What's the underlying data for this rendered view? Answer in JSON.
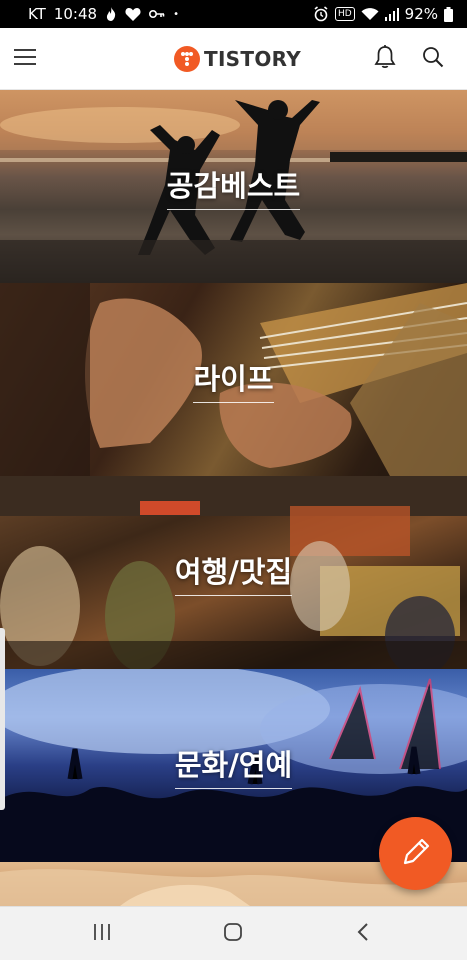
{
  "status_bar": {
    "carrier": "KT",
    "time": "10:48",
    "battery": "92%",
    "dot": "•",
    "hd_badge": "HD"
  },
  "header": {
    "logo_text": "TISTORY",
    "logo_mark": "T"
  },
  "categories": [
    {
      "label": "공감베스트"
    },
    {
      "label": "라이프"
    },
    {
      "label": "여행/맛집"
    },
    {
      "label": "문화/연예"
    }
  ],
  "icons": {
    "menu": "hamburger-menu-icon",
    "notification": "bell-icon",
    "search": "search-icon",
    "compose": "pencil-icon",
    "nav_recent": "recent-apps-icon",
    "nav_home": "home-icon",
    "nav_back": "back-icon"
  },
  "colors": {
    "brand": "#f15a24",
    "header_bg": "#ffffff",
    "nav_bg": "#f2f2f2",
    "status_bg": "#000000"
  }
}
